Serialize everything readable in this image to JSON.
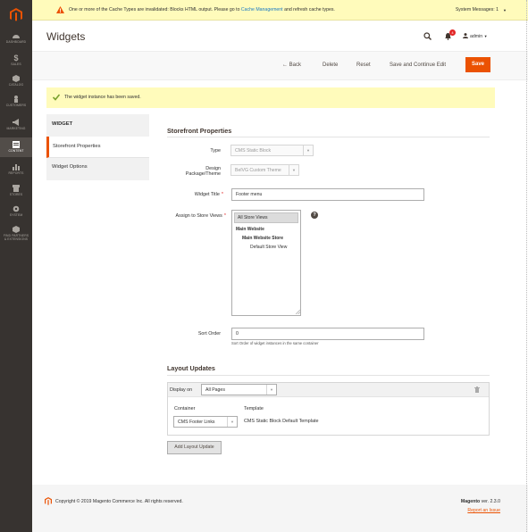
{
  "sidebar": {
    "items": [
      {
        "label": "DASHBOARD",
        "icon": "dashboard-icon"
      },
      {
        "label": "SALES",
        "icon": "dollar-icon"
      },
      {
        "label": "CATALOG",
        "icon": "cube-icon"
      },
      {
        "label": "CUSTOMERS",
        "icon": "person-icon"
      },
      {
        "label": "MARKETING",
        "icon": "megaphone-icon"
      },
      {
        "label": "CONTENT",
        "icon": "content-icon"
      },
      {
        "label": "REPORTS",
        "icon": "bar-chart-icon"
      },
      {
        "label": "STORES",
        "icon": "store-icon"
      },
      {
        "label": "SYSTEM",
        "icon": "gear-icon"
      },
      {
        "label": "FIND PARTNERS",
        "label2": "& EXTENSIONS",
        "icon": "box-icon"
      }
    ]
  },
  "system_bar": {
    "message_before": "One or more of the Cache Types are invalidated: Blocks HTML output. Please go to ",
    "link": "Cache Management",
    "message_after": " and refresh cache types.",
    "system_messages": "System Messages: 1"
  },
  "header": {
    "title": "Widgets",
    "notification_count": "4",
    "user": "admin"
  },
  "actions": {
    "back": "Back",
    "delete": "Delete",
    "reset": "Reset",
    "save_continue": "Save and Continue Edit",
    "save": "Save"
  },
  "success_message": "The widget instance has been saved.",
  "tabs": {
    "heading": "WIDGET",
    "storefront": "Storefront Properties",
    "options": "Widget Options"
  },
  "form": {
    "section_title": "Storefront Properties",
    "type_label": "Type",
    "type_value": "CMS Static Block",
    "theme_label_1": "Design",
    "theme_label_2": "Package/Theme",
    "theme_value": "BelVG Custom Theme",
    "title_label": "Widget Title",
    "title_value": "Footer menu",
    "stores_label": "Assign to Store Views",
    "store_options": [
      "All Store Views",
      "Main Website",
      "Main Website Store",
      "Default Store View"
    ],
    "sort_label": "Sort Order",
    "sort_value": "0",
    "sort_note": "Sort Order of widget instances in the same container"
  },
  "layout_updates": {
    "title": "Layout Updates",
    "display_on_label": "Display on",
    "display_on_value": "All Pages",
    "container_label": "Container",
    "container_value": "CMS Footer Links",
    "template_label": "Template",
    "template_value": "CMS Static Block Default Template",
    "add_button": "Add Layout Update"
  },
  "footer": {
    "copyright": "Copyright © 2019 Magento Commerce Inc. All rights reserved.",
    "brand": "Magento",
    "version": " ver. 2.3.0",
    "report": "Report an Issue"
  },
  "colors": {
    "accent": "#eb5202",
    "sidebar": "#373330",
    "notice": "#fffbbb"
  }
}
